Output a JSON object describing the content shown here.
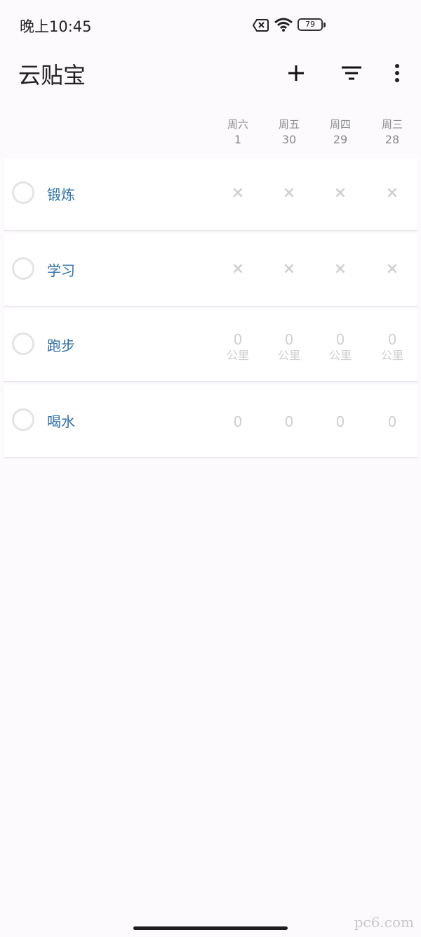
{
  "status_bar": {
    "time": "晚上10:45",
    "battery": "79"
  },
  "app_bar": {
    "title": "云贴宝"
  },
  "days": [
    {
      "weekday": "周六",
      "date": "1"
    },
    {
      "weekday": "周五",
      "date": "30"
    },
    {
      "weekday": "周四",
      "date": "29"
    },
    {
      "weekday": "周三",
      "date": "28"
    }
  ],
  "habits": [
    {
      "name": "锻炼",
      "cells": [
        "×",
        "×",
        "×",
        "×"
      ]
    },
    {
      "name": "学习",
      "cells": [
        "×",
        "×",
        "×",
        "×"
      ]
    },
    {
      "name": "跑步",
      "cells": [
        "0",
        "0",
        "0",
        "0"
      ],
      "unit": "公里"
    },
    {
      "name": "喝水",
      "cells": [
        "0",
        "0",
        "0",
        "0"
      ]
    }
  ],
  "watermark": "pc6.com",
  "colors": {
    "accent": "#2f6ea8",
    "muted": "#cfcfcf",
    "background": "#fcfafd"
  }
}
